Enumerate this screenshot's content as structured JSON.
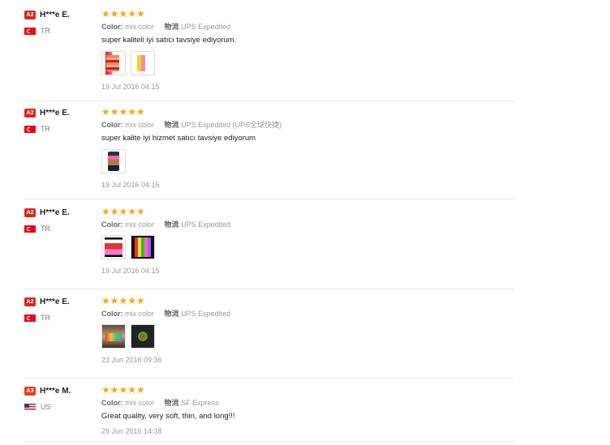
{
  "reviews": [
    {
      "level": "A2",
      "level_class": "a2",
      "name": "H***e E.",
      "country": "TR",
      "flag": "flag-tr",
      "stars": "★★★★★",
      "color_label": "Color:",
      "color_value": "mix color",
      "logistics_label": "物流",
      "logistics_value": "UPS Expedited",
      "text": "super kaliteli iyi satıcı tavsiye ediyorum.",
      "images": [
        "hair-extension-photo-1",
        "hair-extension-photo-2"
      ],
      "image_classes": [
        "t-hair1",
        "t-hair2"
      ],
      "date": "19 Jul 2016 04:15"
    },
    {
      "level": "A2",
      "level_class": "a2",
      "name": "H***e E.",
      "country": "TR",
      "flag": "flag-tr",
      "stars": "★★★★★",
      "color_label": "Color:",
      "color_value": "mix color",
      "logistics_label": "物流",
      "logistics_value": "UPS Expedited (UPS全球快捷)",
      "text": "super kalite iyi hizmet satıcı tavsiye ediyorum",
      "images": [
        "phone-photo"
      ],
      "image_classes": [
        "t-phone"
      ],
      "date": "19 Jul 2016 04:15"
    },
    {
      "level": "A2",
      "level_class": "a2",
      "name": "H***e E.",
      "country": "TR",
      "flag": "flag-tr",
      "stars": "★★★★★",
      "color_label": "Color:",
      "color_value": "mix color",
      "logistics_label": "物流",
      "logistics_value": "UPS Expedited",
      "text": "",
      "images": [
        "hair-extension-photo-3",
        "hair-extension-photo-4"
      ],
      "image_classes": [
        "t-hair3",
        "t-hair4"
      ],
      "date": "19 Jul 2016 04:15"
    },
    {
      "level": "A2",
      "level_class": "a2",
      "name": "H***e E.",
      "country": "TR",
      "flag": "flag-tr",
      "stars": "★★★★★",
      "color_label": "Color:",
      "color_value": "mix color",
      "logistics_label": "物流",
      "logistics_value": "UPS Expedited",
      "text": "",
      "images": [
        "customer-photo-1",
        "customer-photo-2"
      ],
      "image_classes": [
        "t-photo1",
        "t-photo2"
      ],
      "date": "23 Jun 2016 09:36"
    },
    {
      "level": "A3",
      "level_class": "a3",
      "name": "H***e M.",
      "country": "US",
      "flag": "flag-us",
      "stars": "★★★★★",
      "color_label": "Color:",
      "color_value": "mix color",
      "logistics_label": "物流",
      "logistics_value": "SF Express",
      "text": "Great quality, very soft, thin, and long!!!",
      "images": [],
      "image_classes": [],
      "date": "29 Jun 2016 14:38"
    }
  ]
}
